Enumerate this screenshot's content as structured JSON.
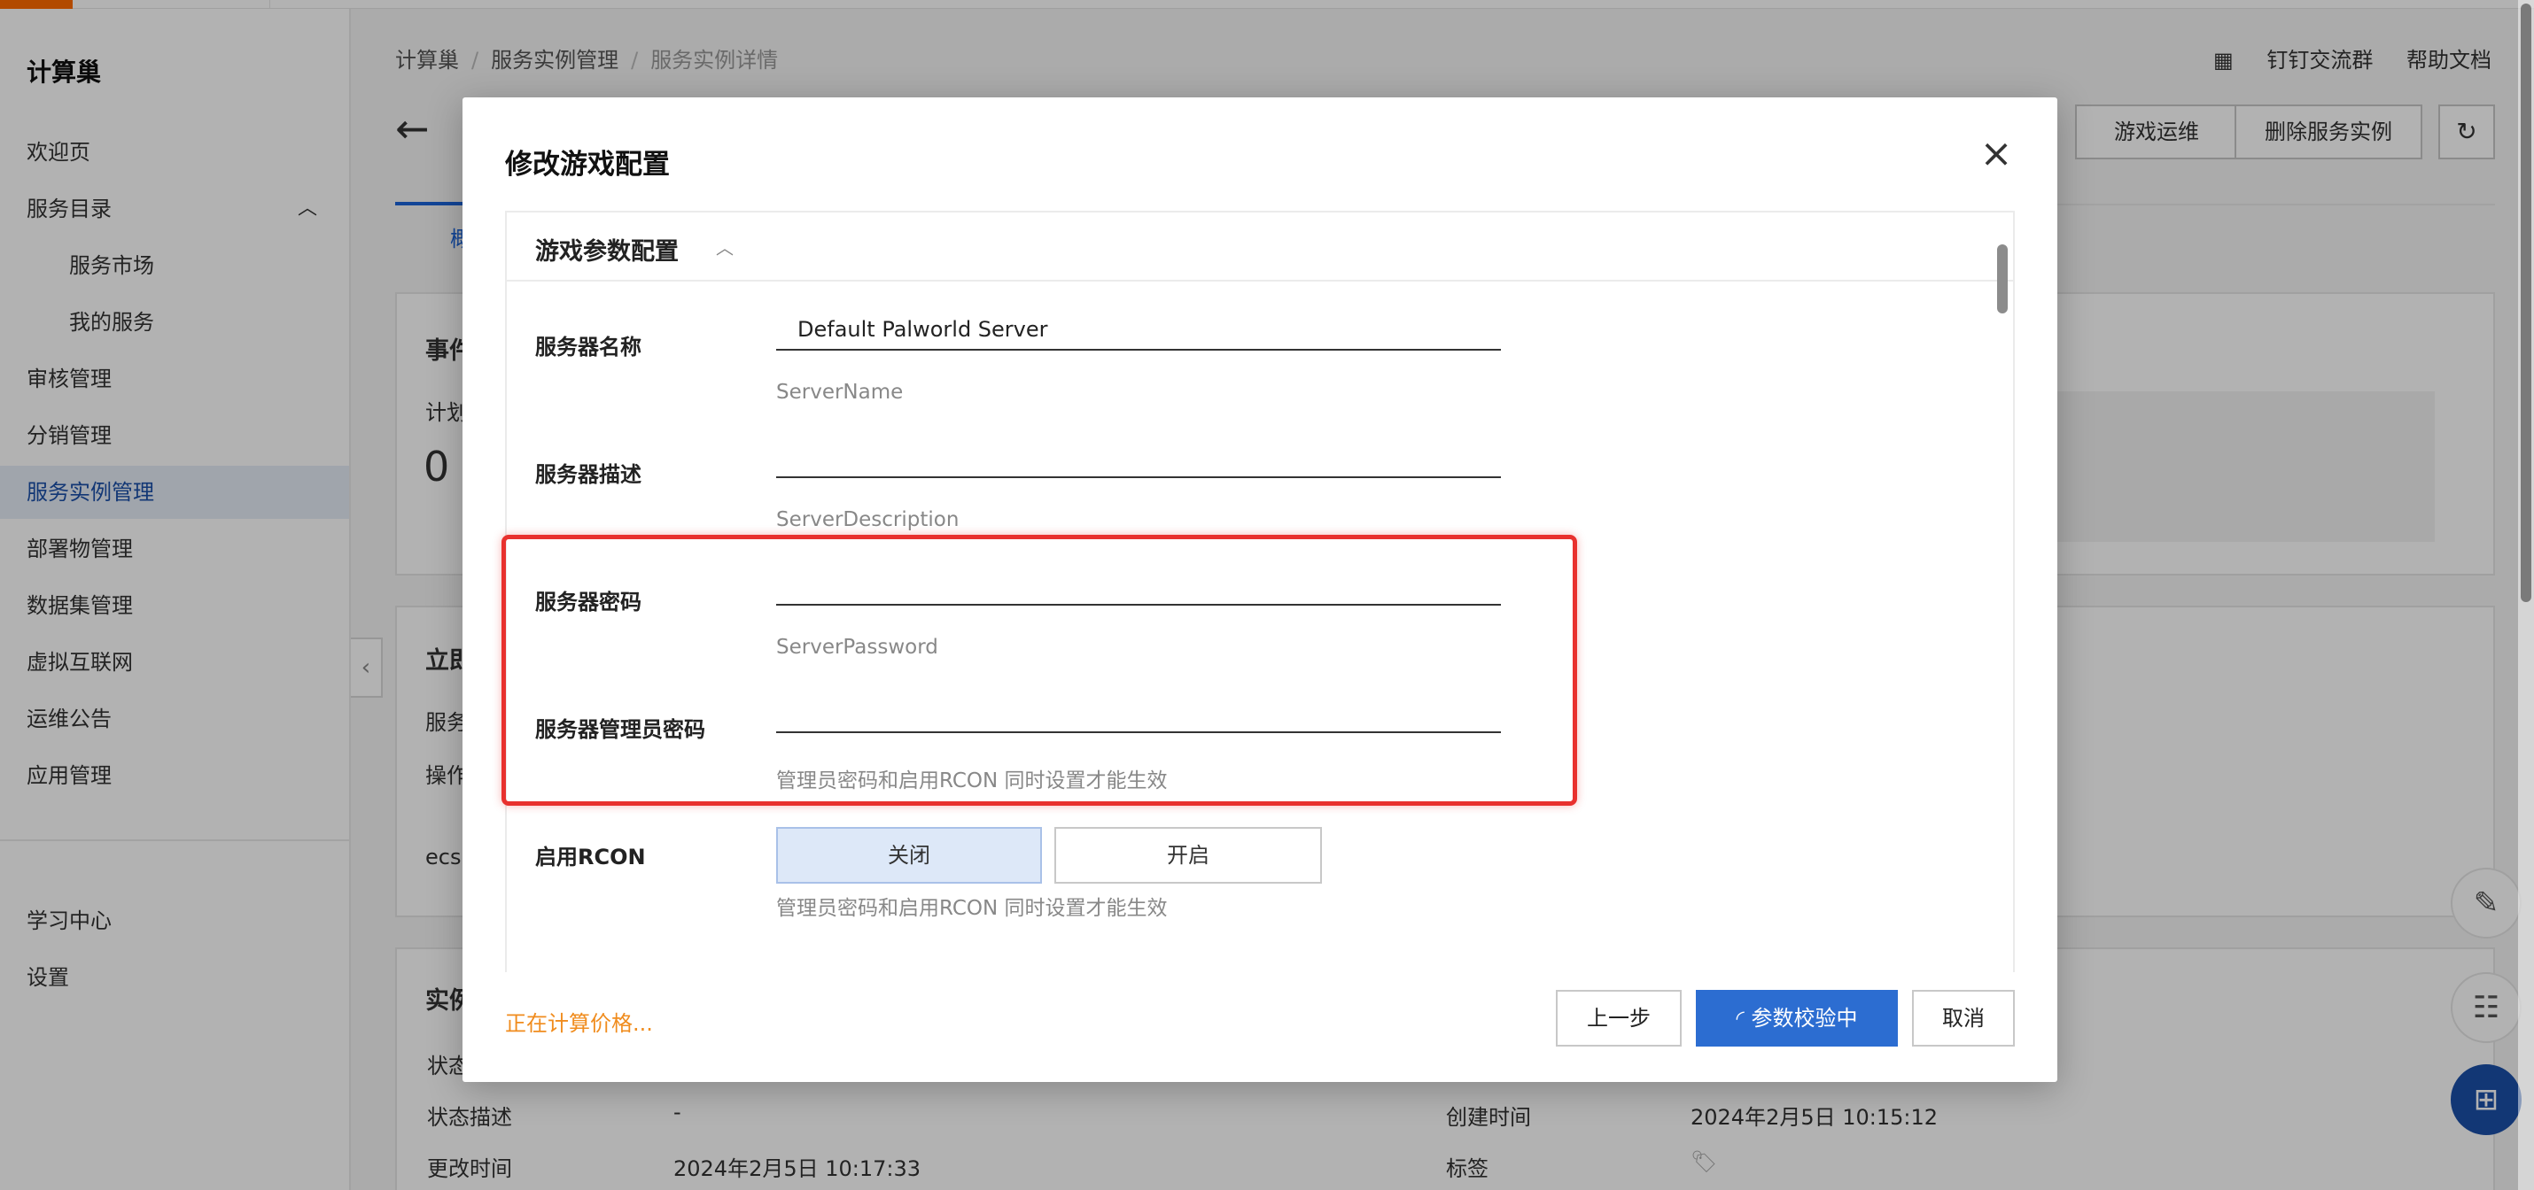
{
  "colors": {
    "accent": "#1b4fa8",
    "primary_button": "#2c6dd1",
    "highlight": "#e8312e",
    "warning_text": "#f08c1e"
  },
  "sidebar": {
    "title": "计算巢",
    "items": [
      {
        "label": "欢迎页"
      },
      {
        "label": "服务目录"
      },
      {
        "label": "服务市场"
      },
      {
        "label": "我的服务"
      },
      {
        "label": "审核管理"
      },
      {
        "label": "分销管理"
      },
      {
        "label": "服务实例管理",
        "active": true
      },
      {
        "label": "部署物管理"
      },
      {
        "label": "数据集管理"
      },
      {
        "label": "虚拟互联网"
      },
      {
        "label": "运维公告"
      },
      {
        "label": "应用管理"
      }
    ],
    "bottom_items": [
      {
        "label": "学习中心"
      },
      {
        "label": "设置"
      }
    ]
  },
  "breadcrumb": [
    "计算巢",
    "服务实例管理",
    "服务实例详情"
  ],
  "top_links": [
    "钉钉交流群",
    "帮助文档"
  ],
  "header_buttons": {
    "ops": "游戏运维",
    "delete": "删除服务实例"
  },
  "background_fragments": {
    "tab_partial": "概",
    "events_title": "事件",
    "plan_label": "计划",
    "plan_count": "0",
    "immediate_title": "立即",
    "service_label": "服务",
    "operation_label": "操作",
    "ecs_text": "ecs",
    "instance_title": "实例",
    "status_label": "状态",
    "status_desc_label": "状态描述",
    "status_desc_value": "-",
    "modified_label": "更改时间",
    "modified_value": "2024年2月5日 10:17:33",
    "created_label": "创建时间",
    "created_value": "2024年2月5日 10:15:12",
    "tags_label": "标签"
  },
  "modal": {
    "title": "修改游戏配置",
    "section_title": "游戏参数配置",
    "fields": [
      {
        "label": "服务器名称",
        "value": "Default Palworld Server",
        "hint": "ServerName"
      },
      {
        "label": "服务器描述",
        "value": "",
        "hint": "ServerDescription"
      },
      {
        "label": "服务器密码",
        "value": "",
        "hint": "ServerPassword"
      },
      {
        "label": "服务器管理员密码",
        "value": "",
        "hint": "管理员密码和启用RCON 同时设置才能生效"
      }
    ],
    "rcon": {
      "label": "启用RCON",
      "off_label": "关闭",
      "on_label": "开启",
      "selected": "关闭",
      "hint": "管理员密码和启用RCON 同时设置才能生效"
    },
    "footer": {
      "price_status": "正在计算价格...",
      "prev_button": "上一步",
      "validate_button": "参数校验中",
      "cancel_button": "取消"
    }
  }
}
